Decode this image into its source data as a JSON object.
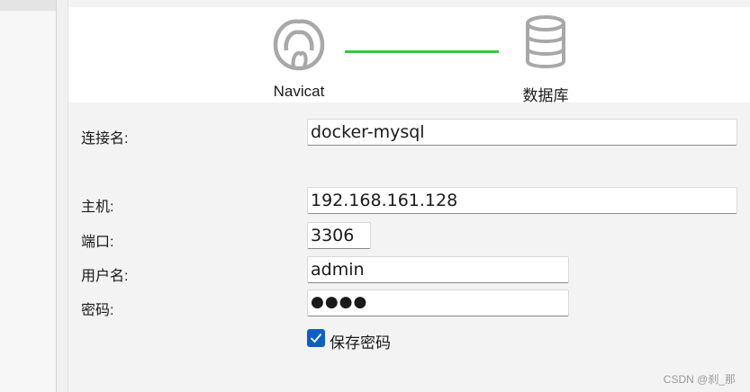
{
  "header": {
    "source_label": "Navicat",
    "target_label": "数据库",
    "line_color": "#3cc44a",
    "source_icon": "navicat-logo-icon",
    "target_icon": "database-icon"
  },
  "form": {
    "connection_name": {
      "label": "连接名:",
      "value": "docker-mysql"
    },
    "host": {
      "label": "主机:",
      "value": "192.168.161.128"
    },
    "port": {
      "label": "端口:",
      "value": "3306"
    },
    "username": {
      "label": "用户名:",
      "value": "admin"
    },
    "password": {
      "label": "密码:",
      "value": "●●●●"
    },
    "save_password": {
      "label": "保存密码",
      "checked": true
    }
  },
  "watermark": "CSDN @刹_那",
  "colors": {
    "accent": "#0f5fbf"
  }
}
